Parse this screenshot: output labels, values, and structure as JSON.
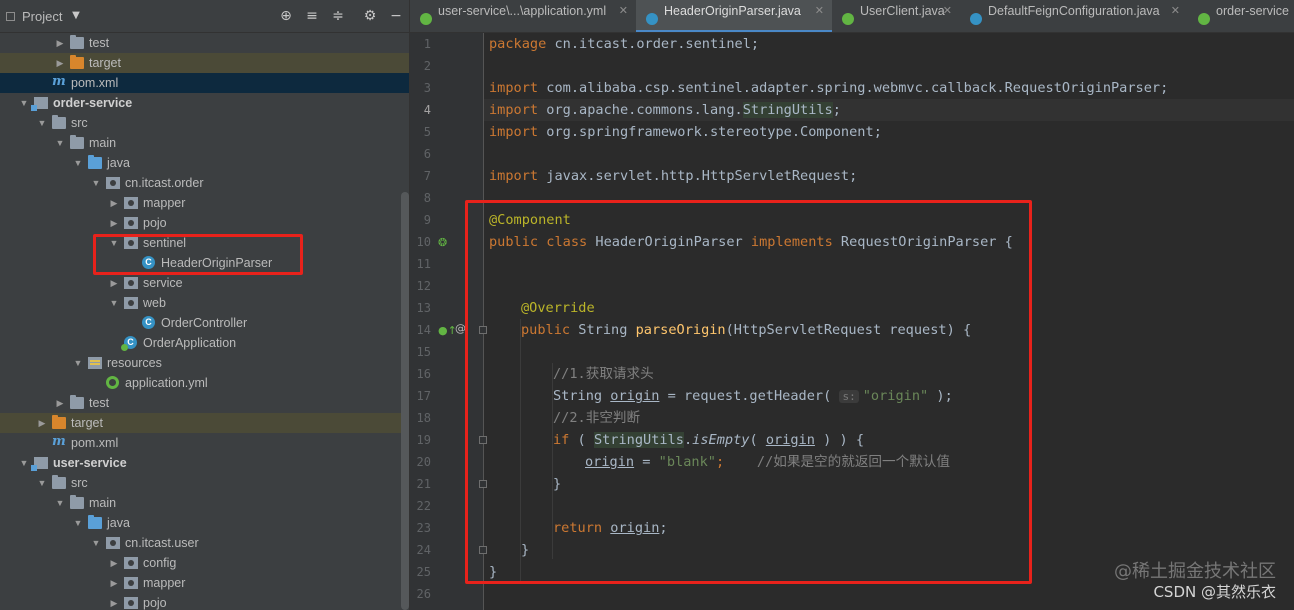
{
  "project_panel": {
    "title": "Project",
    "header_icons": [
      "dropdown-icon",
      "locate-icon",
      "expand-all-icon",
      "collapse-all-icon",
      "settings-icon",
      "hide-icon"
    ],
    "tree": [
      {
        "label": "test",
        "icon": "folder",
        "expanded": false
      },
      {
        "label": "target",
        "icon": "folder-orange",
        "expanded": false
      },
      {
        "label": "pom.xml",
        "icon": "maven"
      },
      {
        "label": "order-service",
        "icon": "module",
        "expanded": true
      },
      {
        "label": "src",
        "icon": "folder",
        "expanded": true
      },
      {
        "label": "main",
        "icon": "folder",
        "expanded": true
      },
      {
        "label": "java",
        "icon": "folder-blue",
        "expanded": true
      },
      {
        "label": "cn.itcast.order",
        "icon": "package",
        "expanded": true
      },
      {
        "label": "mapper",
        "icon": "package",
        "expanded": false
      },
      {
        "label": "pojo",
        "icon": "package",
        "expanded": false
      },
      {
        "label": "sentinel",
        "icon": "package",
        "expanded": true
      },
      {
        "label": "HeaderOriginParser",
        "icon": "class"
      },
      {
        "label": "service",
        "icon": "package",
        "expanded": false
      },
      {
        "label": "web",
        "icon": "package",
        "expanded": true
      },
      {
        "label": "OrderController",
        "icon": "class"
      },
      {
        "label": "OrderApplication",
        "icon": "spring-app"
      },
      {
        "label": "resources",
        "icon": "resources",
        "expanded": true
      },
      {
        "label": "application.yml",
        "icon": "yaml"
      },
      {
        "label": "test",
        "icon": "folder",
        "expanded": false
      },
      {
        "label": "target",
        "icon": "folder-orange",
        "expanded": false
      },
      {
        "label": "pom.xml",
        "icon": "maven"
      },
      {
        "label": "user-service",
        "icon": "module",
        "expanded": true
      },
      {
        "label": "src",
        "icon": "folder",
        "expanded": true
      },
      {
        "label": "main",
        "icon": "folder",
        "expanded": true
      },
      {
        "label": "java",
        "icon": "folder-blue",
        "expanded": true
      },
      {
        "label": "cn.itcast.user",
        "icon": "package",
        "expanded": true
      },
      {
        "label": "config",
        "icon": "package",
        "expanded": false
      },
      {
        "label": "mapper",
        "icon": "package",
        "expanded": false
      },
      {
        "label": "pojo",
        "icon": "package",
        "expanded": false
      }
    ]
  },
  "tabs": [
    {
      "label": "user-service\\...\\application.yml",
      "icon": "yaml",
      "active": false
    },
    {
      "label": "HeaderOriginParser.java",
      "icon": "class",
      "active": true
    },
    {
      "label": "UserClient.java",
      "icon": "interface",
      "active": false
    },
    {
      "label": "DefaultFeignConfiguration.java",
      "icon": "class",
      "active": false
    },
    {
      "label": "order-service",
      "icon": "yaml",
      "active": false
    }
  ],
  "editor": {
    "current_line": 4,
    "line_numbers": [
      "1",
      "2",
      "3",
      "4",
      "5",
      "6",
      "7",
      "8",
      "9",
      "10",
      "11",
      "12",
      "13",
      "14",
      "15",
      "16",
      "17",
      "18",
      "19",
      "20",
      "21",
      "22",
      "23",
      "24",
      "25",
      "26"
    ],
    "code": {
      "l1_kw": "package",
      "l1_rest": " cn.itcast.order.sentinel;",
      "l3_kw": "import",
      "l3_rest": " com.alibaba.csp.sentinel.adapter.spring.webmvc.callback.RequestOriginParser;",
      "l4_kw": "import",
      "l4_a": " org.apache.commons.lang.",
      "l4_b": "StringUtils",
      "l4_c": ";",
      "l5_kw": "import",
      "l5_a": " org.springframework.stereotype.",
      "l5_b": "Component",
      "l5_c": ";",
      "l7_kw": "import",
      "l7_rest": " javax.servlet.http.HttpServletRequest;",
      "l9_an": "@Component",
      "l10_kw1": "public class",
      "l10_a": " HeaderOriginParser ",
      "l10_kw2": "implements",
      "l10_b": " RequestOriginParser {",
      "l13_an": "@Override",
      "l14_kw": "public",
      "l14_a": " String ",
      "l14_fn": "parseOrigin",
      "l14_b": "(HttpServletRequest request) {",
      "l16_cm": "//1.获取请求头",
      "l17_a": "String ",
      "l17_var": "origin",
      "l17_b": " = request.getHeader( ",
      "l17_hint": "s:",
      "l17_str": "\"origin\"",
      "l17_c": " );",
      "l18_cm": "//2.非空判断",
      "l19_kw": "if",
      "l19_a": " ( ",
      "l19_cls": "StringUtils",
      "l19_b": ".",
      "l19_it": "isEmpty",
      "l19_c": "( ",
      "l19_var": "origin",
      "l19_d": " ) ) {",
      "l20_var": "origin",
      "l20_a": " = ",
      "l20_str": "\"blank\"",
      "l20_b": ";    ",
      "l20_cm": "//如果是空的就返回一个默认值",
      "l21": "}",
      "l23_kw": "return",
      "l23_a": " ",
      "l23_var": "origin",
      "l23_b": ";",
      "l24": "}",
      "l25": "}"
    }
  },
  "watermark": {
    "line1": "@稀土掘金技术社区",
    "line2": "CSDN @其然乐衣"
  },
  "colors": {
    "annotation_red": "#e8221b",
    "keyword": "#cc7832",
    "annotation": "#bbb529",
    "string": "#6a8759",
    "comment": "#808080",
    "method": "#ffc66d"
  }
}
